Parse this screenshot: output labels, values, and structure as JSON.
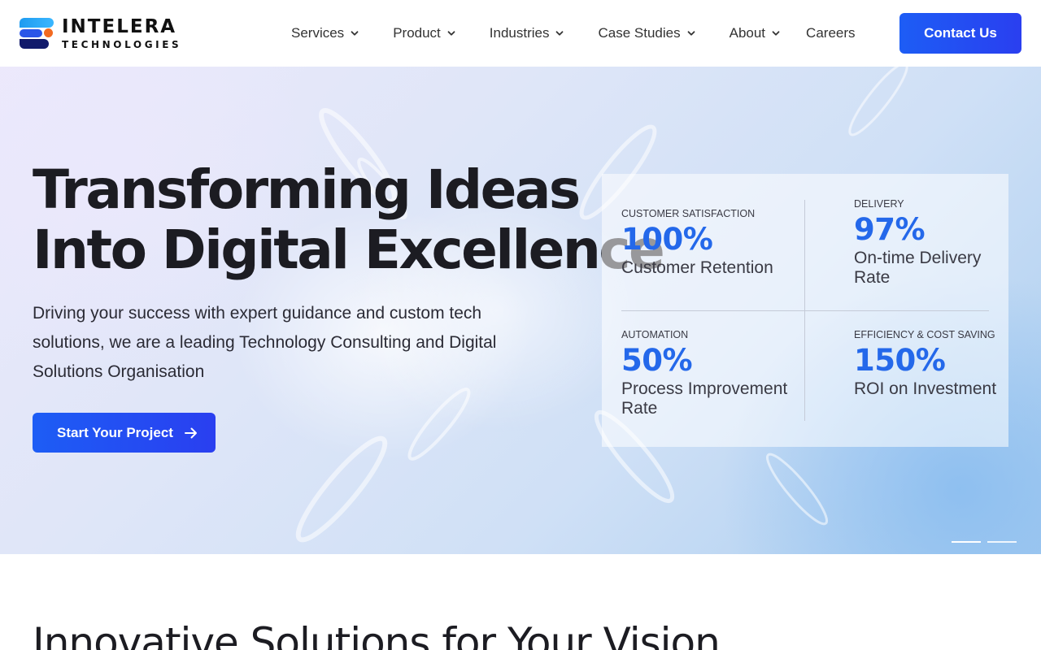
{
  "brand": {
    "name": "INTELERA",
    "tagline": "TECHNOLOGIES",
    "colors": {
      "accent": "#1d5df5",
      "stat_blue": "#2468ea",
      "logo_orange": "#f26a21",
      "logo_navy": "#111a6b"
    }
  },
  "nav": {
    "items": [
      {
        "label": "Services",
        "icon": "chevron-down-icon"
      },
      {
        "label": "Product",
        "icon": "chevron-down-icon"
      },
      {
        "label": "Industries",
        "icon": "chevron-down-icon"
      },
      {
        "label": "Case Studies",
        "icon": "chevron-down-icon"
      },
      {
        "label": "About",
        "icon": "chevron-down-icon"
      },
      {
        "label": "Careers"
      }
    ],
    "cta": "Contact Us"
  },
  "hero": {
    "title_line1": "Transforming Ideas",
    "title_line2": "Into Digital Excellence",
    "description": "Driving your success with expert guidance and custom tech solutions, we are a leading Technology Consulting and Digital Solutions Organisation",
    "button": "Start Your Project",
    "button_icon": "arrow-right-icon",
    "slides": 2,
    "active_slide": 1
  },
  "stats": [
    {
      "caption": "CUSTOMER SATISFACTION",
      "value": "100%",
      "label": "Customer Retention"
    },
    {
      "caption": "DELIVERY",
      "value": "97%",
      "label": "On-time Delivery Rate"
    },
    {
      "caption": "AUTOMATION",
      "value": "50%",
      "label": "Process Improvement Rate"
    },
    {
      "caption": "EFFICIENCY & COST SAVING",
      "value": "150%",
      "label": "ROI on Investment"
    }
  ],
  "next_section": {
    "title": "Innovative Solutions for Your Vision"
  }
}
